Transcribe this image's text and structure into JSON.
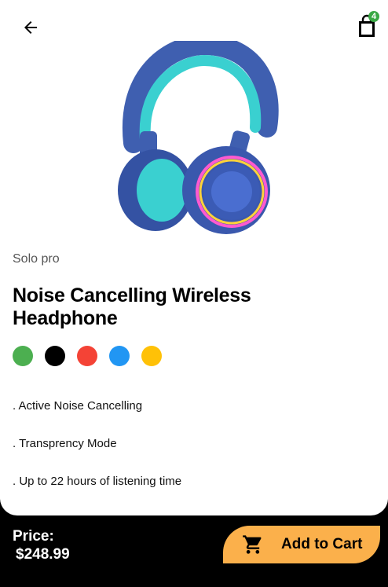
{
  "header": {
    "back_icon": "arrow-left-icon",
    "cart_icon": "shopping-bag-icon",
    "cart_count": "4"
  },
  "product": {
    "image_icon": "headphones-image",
    "brand": "Solo pro",
    "title": "Noise Cancelling Wireless Headphone",
    "colors": [
      "#4caf50",
      "#000000",
      "#f44336",
      "#2196f3",
      "#ffc107"
    ],
    "features": [
      ". Active Noise Cancelling",
      ". Transprency Mode",
      ". Up to 22 hours of listening time"
    ]
  },
  "footer": {
    "price_label": "Price:",
    "price_value": "$248.99",
    "add_to_cart_label": "Add to Cart",
    "add_to_cart_icon": "cart-icon",
    "accent": "#fbb04b"
  }
}
